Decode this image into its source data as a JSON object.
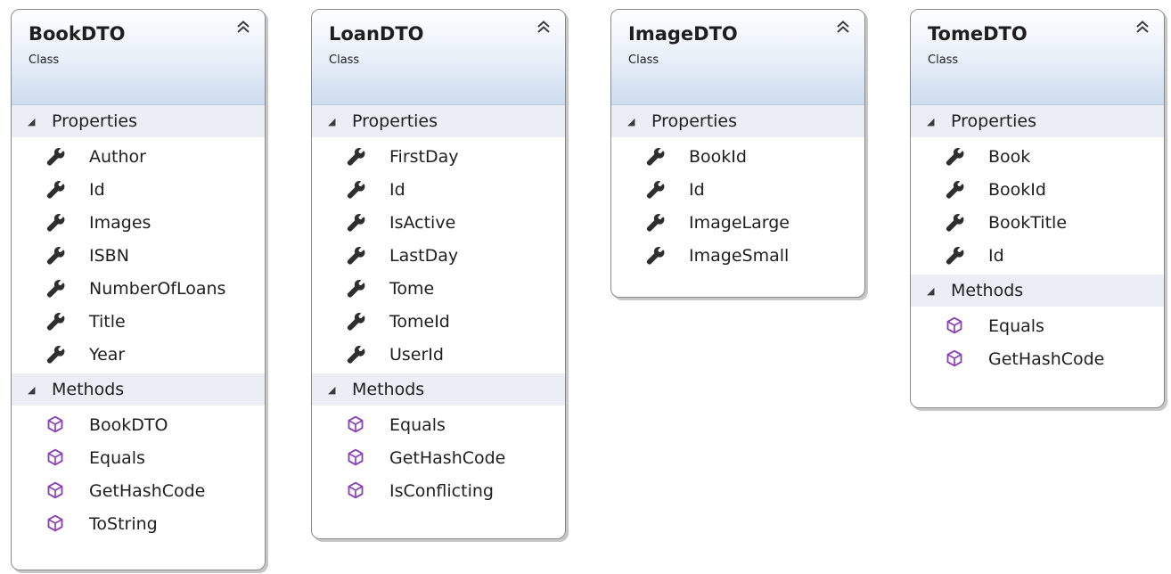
{
  "labels": {
    "properties": "Properties",
    "methods": "Methods"
  },
  "icons": {
    "property": "wrench-icon",
    "method": "method-cube-icon",
    "collapse": "double-chevron-up-icon",
    "section_toggle": "triangle-down-icon"
  },
  "colors": {
    "header_gradient_top": "#ffffff",
    "header_gradient_bottom": "#cddcef",
    "section_bg": "#ebeff5",
    "method_icon": "#8a3fb8",
    "border": "#8a8a8a"
  },
  "classes": [
    {
      "name": "BookDTO",
      "kind": "Class",
      "properties": [
        "Author",
        "Id",
        "Images",
        "ISBN",
        "NumberOfLoans",
        "Title",
        "Year"
      ],
      "methods": [
        "BookDTO",
        "Equals",
        "GetHashCode",
        "ToString"
      ]
    },
    {
      "name": "LoanDTO",
      "kind": "Class",
      "properties": [
        "FirstDay",
        "Id",
        "IsActive",
        "LastDay",
        "Tome",
        "TomeId",
        "UserId"
      ],
      "methods": [
        "Equals",
        "GetHashCode",
        "IsConflicting"
      ]
    },
    {
      "name": "ImageDTO",
      "kind": "Class",
      "properties": [
        "BookId",
        "Id",
        "ImageLarge",
        "ImageSmall"
      ],
      "methods": []
    },
    {
      "name": "TomeDTO",
      "kind": "Class",
      "properties": [
        "Book",
        "BookId",
        "BookTitle",
        "Id"
      ],
      "methods": [
        "Equals",
        "GetHashCode"
      ]
    }
  ]
}
